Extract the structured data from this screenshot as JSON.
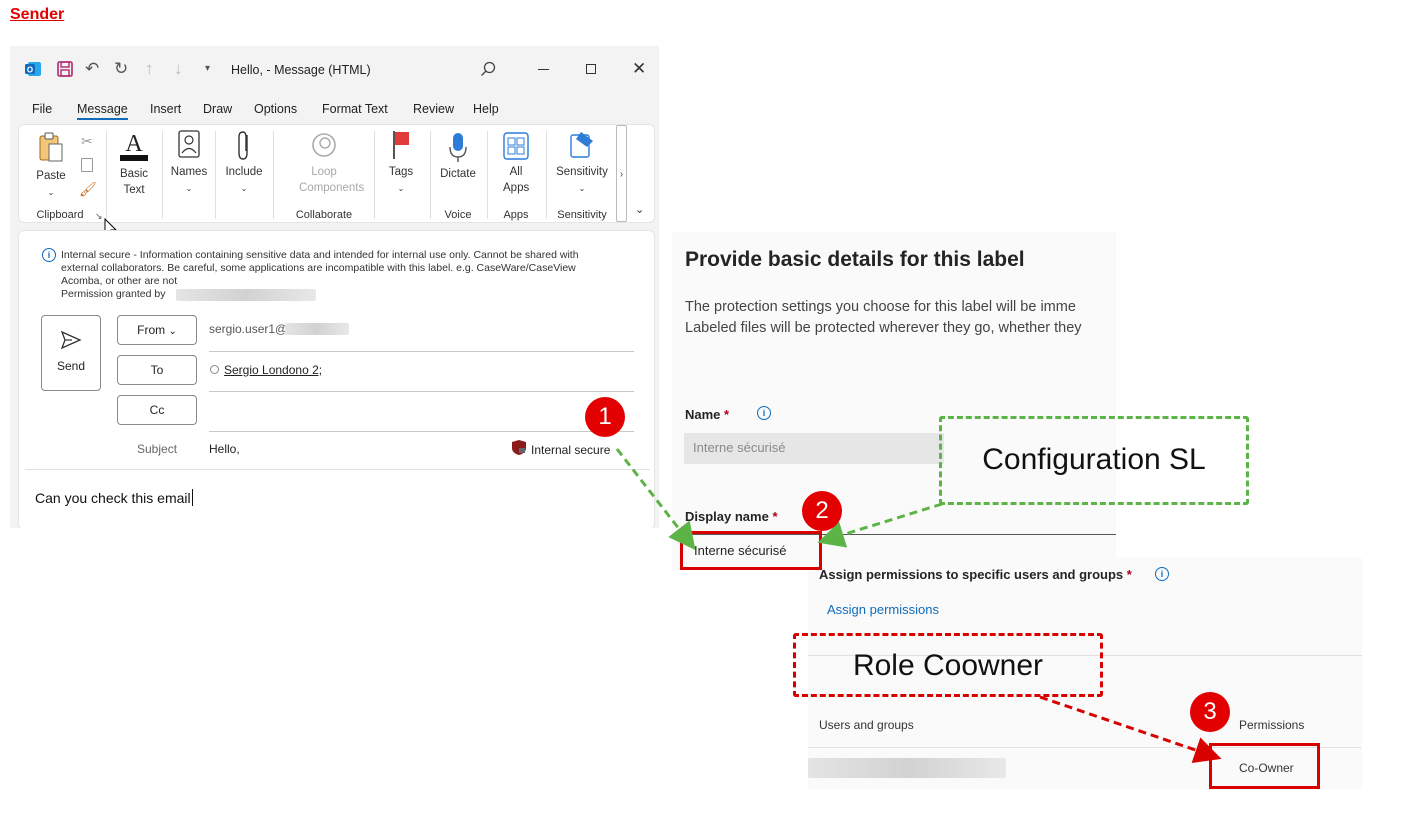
{
  "heading": "Sender",
  "outlook": {
    "window_title": "Hello,  - Message (HTML)",
    "menu": [
      "File",
      "Message",
      "Insert",
      "Draw",
      "Options",
      "Format Text",
      "Review",
      "Help"
    ],
    "ribbon": {
      "paste": "Paste",
      "basic_text": "Basic Text",
      "names": "Names",
      "include": "Include",
      "loop_components": "Loop Components",
      "tags": "Tags",
      "dictate": "Dictate",
      "all_apps": "All Apps",
      "sensitivity": "Sensitivity",
      "groups": {
        "clipboard": "Clipboard",
        "collaborate": "Collaborate",
        "voice": "Voice",
        "apps": "Apps",
        "sensitivity": "Sensitivity"
      }
    },
    "info_bar": {
      "line1": "Internal secure - Information containing sensitive data and intended for internal use only. Cannot be shared with",
      "line2": "external collaborators.  Be careful, some applications are incompatible with this label.  e.g. CaseWare/CaseView",
      "line3": "Acomba, or other are not",
      "line4": "Permission granted by"
    },
    "send_label": "Send",
    "from_label": "From",
    "from_value": "sergio.user1@",
    "to_label": "To",
    "to_value": "Sergio Londono 2;",
    "cc_label": "Cc",
    "subject_label": "Subject",
    "subject_value": "Hello,",
    "sensitivity_tag": "Internal secure",
    "body": "Can you check this email"
  },
  "purview": {
    "title": "Provide basic details for this label",
    "desc_line1": "The protection settings you choose for this label will be imme",
    "desc_line2": "Labeled files will be protected wherever they go, whether they",
    "name_label": "Name",
    "name_value": "Interne sécurisé",
    "display_name_label": "Display name",
    "display_name_value": "Interne sécurisé",
    "assign_title": "Assign permissions to specific users and groups",
    "assign_link": "Assign permissions",
    "col_users": "Users and groups",
    "col_permissions": "Permissions",
    "row_permission": "Co-Owner",
    "required_mark": "*"
  },
  "annotations": {
    "config_label": "Configuration SL",
    "role_label": "Role Coowner",
    "n1": "1",
    "n2": "2",
    "n3": "3",
    "green": "#5db446",
    "red": "#d90000"
  }
}
